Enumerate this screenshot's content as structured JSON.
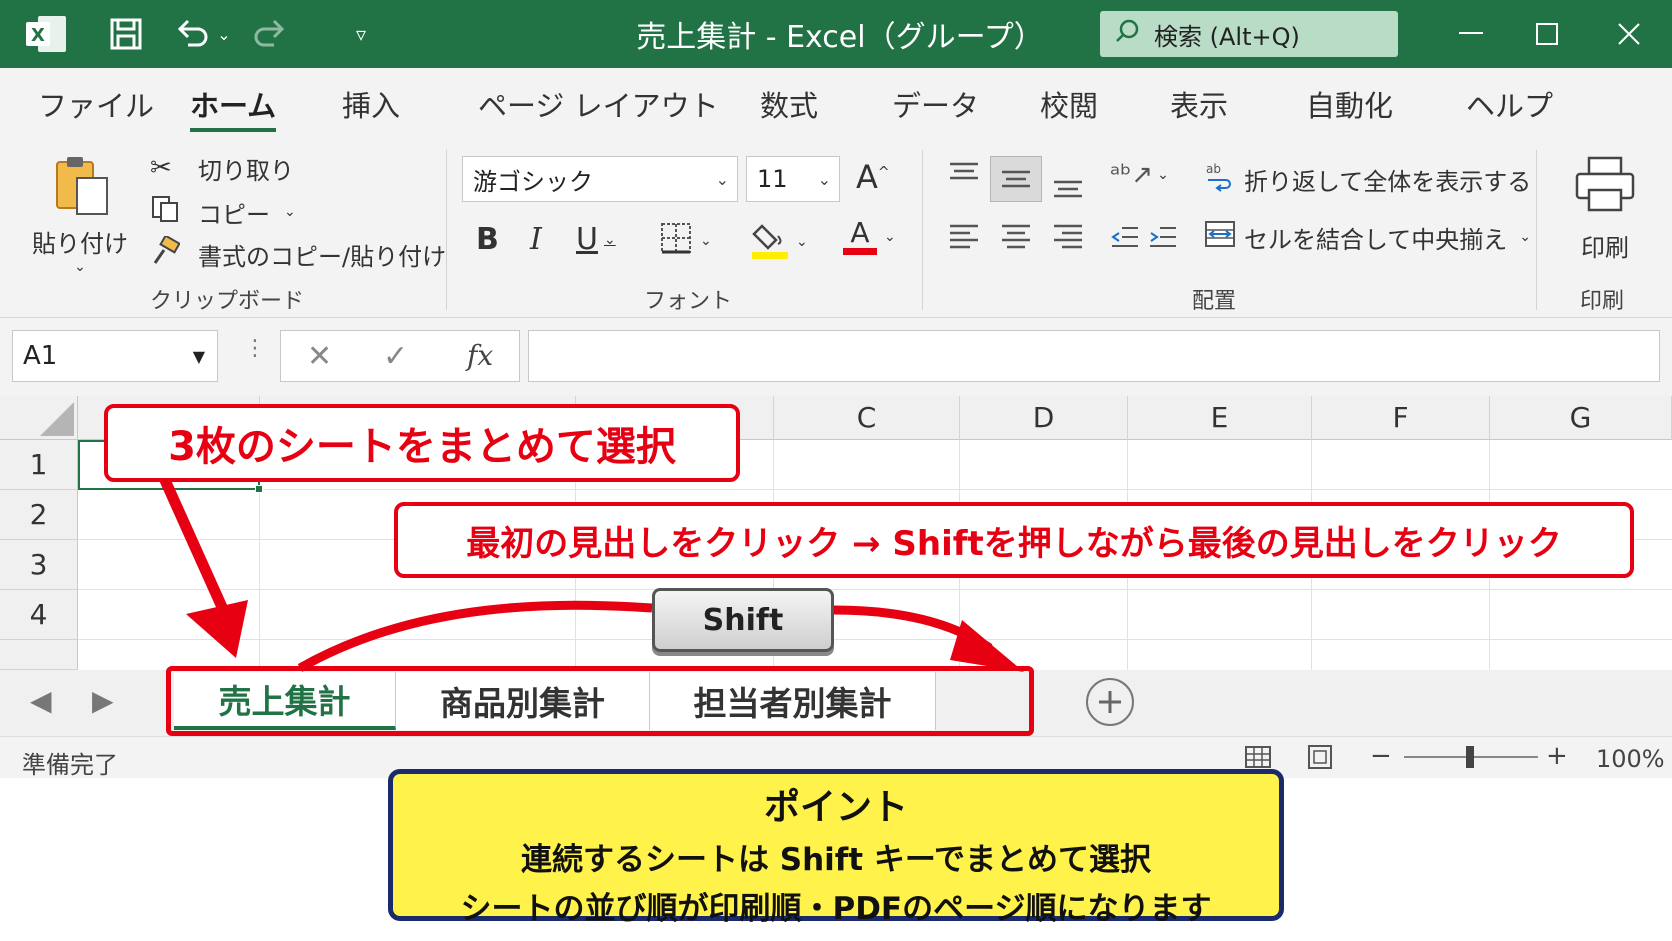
{
  "window": {
    "title": "売上集計 - Excel（グループ）",
    "search_placeholder": "検索 (Alt+Q)",
    "accent": "#217346"
  },
  "ribbon_tabs": [
    "ファイル",
    "ホーム",
    "挿入",
    "ページ レイアウト",
    "数式",
    "データ",
    "校閲",
    "表示",
    "自動化",
    "ヘルプ"
  ],
  "active_tab": "ホーム",
  "clipboard": {
    "paste": "貼り付け",
    "cut": "切り取り",
    "copy": "コピー",
    "format_painter": "書式のコピー/貼り付け",
    "group_label": "クリップボード"
  },
  "font": {
    "family": "游ゴシック",
    "size": "11",
    "bold": "B",
    "italic": "I",
    "underline": "U",
    "font_color_letter": "A",
    "group_label": "フォント"
  },
  "alignment": {
    "wrap_text": "折り返して全体を表示する",
    "merge_center": "セルを結合して中央揃え",
    "group_label": "配置"
  },
  "print": {
    "button": "印刷",
    "group_label": "印刷"
  },
  "formula_bar": {
    "name_box": "A1",
    "fx": "fx",
    "value": ""
  },
  "columns": [
    "C",
    "D",
    "E",
    "F",
    "G"
  ],
  "rows": [
    "1",
    "2",
    "3",
    "4"
  ],
  "sheet_tabs": [
    "売上集計",
    "商品別集計",
    "担当者別集計"
  ],
  "active_sheet": "売上集計",
  "status": {
    "ready": "準備完了",
    "zoom": "100%"
  },
  "annotations": {
    "title_callout": "3枚のシートをまとめて選択",
    "instruction": "最初の見出しをクリック → Shiftを押しながら最後の見出しをクリック",
    "key_label": "Shift",
    "point_title": "ポイント",
    "point_line1": "連続するシートは Shift キーでまとめて選択",
    "point_line2": "シートの並び順が印刷順・PDFのページ順になります",
    "callout_color": "#e60012",
    "point_bg": "#fff24a"
  }
}
